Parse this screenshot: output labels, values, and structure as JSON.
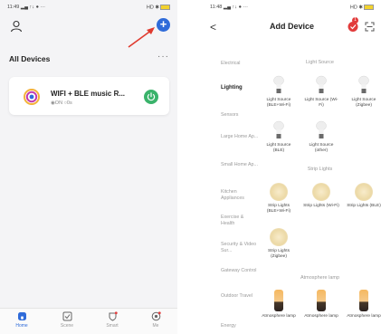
{
  "left": {
    "status_time": "11:49",
    "status_signal": "▂▄ ↑↓ ● ···",
    "status_right": "HD ✱",
    "all_devices_title": "All Devices",
    "more": "···",
    "device": {
      "name": "WIFI + BLE music R...",
      "status": "◉ON  ○0s"
    },
    "tabs": [
      {
        "label": "Home",
        "icon": "home-icon"
      },
      {
        "label": "Scene",
        "icon": "scene-icon"
      },
      {
        "label": "Smart",
        "icon": "smart-icon"
      },
      {
        "label": "Me",
        "icon": "me-icon"
      }
    ],
    "active_tab": "Home",
    "accent_color": "#2f6bd9",
    "power_color": "#3ab36b"
  },
  "right": {
    "status_time": "11:48",
    "status_signal": "▂▄ ↑↓ ● ···",
    "status_right": "HD ✱",
    "back": "<",
    "title": "Add Device",
    "badge_count": "1",
    "categories": [
      "Electrical",
      "Lighting",
      "Sensors",
      "Large Home Ap...",
      "Small Home Ap...",
      "Kitchen Appliances",
      "Exercise & Health",
      "Security & Video Sur...",
      "Gateway Control",
      "Outdoor Travel",
      "Energy"
    ],
    "active_category": "Lighting",
    "sections": {
      "light_source": {
        "title": "Light Source",
        "items": [
          "Light Source (BLE+Wi-Fi)",
          "Light Source (Wi-Fi)",
          "Light Source (Zigbee)",
          "Light Source (BLE)",
          "Light Source (other)"
        ]
      },
      "strip_lights": {
        "title": "Strip Lights",
        "items": [
          "Strip Lights (BLE+Wi-Fi)",
          "Strip Lights (Wi-Fi)",
          "Strip Lights (BLE)",
          "Strip Lights (Zigbee)"
        ]
      },
      "atmosphere_lamp": {
        "title": "Atmosphere lamp",
        "items": [
          "Atmosphere lamp",
          "Atmosphere lamp",
          "Atmosphere lamp"
        ]
      }
    }
  }
}
